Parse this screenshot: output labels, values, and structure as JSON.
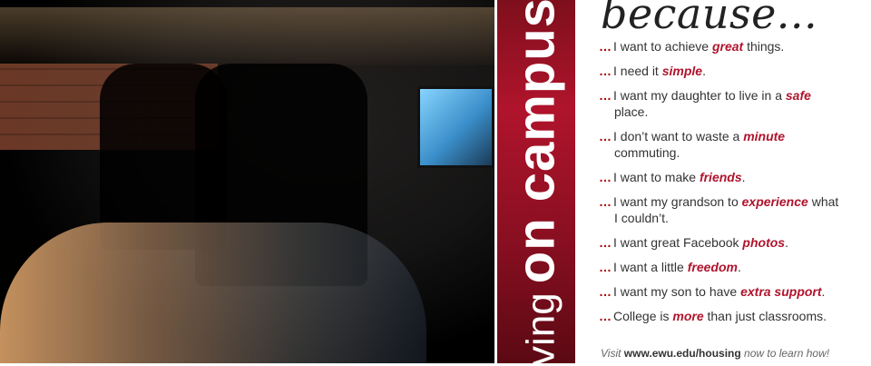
{
  "band": {
    "prefix": "ving",
    "text": "on campus"
  },
  "headline": "because...",
  "items": [
    {
      "dots": "…",
      "a": "I want to achieve ",
      "em": "great",
      "b": " things.",
      "line2": ""
    },
    {
      "dots": "…",
      "a": "I need it ",
      "em": "simple",
      "b": ".",
      "line2": ""
    },
    {
      "dots": "…",
      "a": "I want my daughter to live in a ",
      "em": "safe",
      "b": "",
      "line2": "place."
    },
    {
      "dots": "…",
      "a": "I don’t want to waste a ",
      "em": "minute",
      "b": "",
      "line2": "commuting."
    },
    {
      "dots": "…",
      "a": "I want to make ",
      "em": "friends",
      "b": ".",
      "line2": ""
    },
    {
      "dots": "…",
      "a": "I want my grandson to ",
      "em": "experience",
      "b": " what",
      "line2": "I couldn’t."
    },
    {
      "dots": "…",
      "a": "I want great Facebook ",
      "em": "photos",
      "b": ".",
      "line2": ""
    },
    {
      "dots": "…",
      "a": "I want a little ",
      "em": "freedom",
      "b": ".",
      "line2": ""
    },
    {
      "dots": "…",
      "a": "I want my son to have ",
      "em": "extra support",
      "b": ".",
      "line2": ""
    },
    {
      "dots": "…",
      "a": "College is ",
      "em": "more",
      "b": " than just classrooms.",
      "line2": ""
    }
  ],
  "footer": {
    "pre": "Visit ",
    "url": "www.ewu.edu/housing",
    "post": " now to learn how!"
  }
}
